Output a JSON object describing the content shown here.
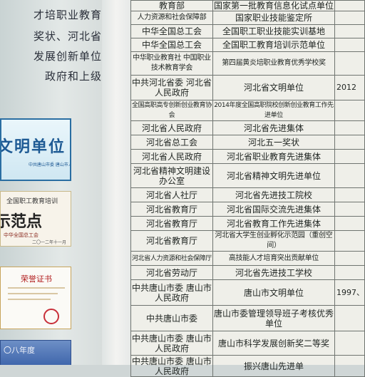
{
  "intro": {
    "lines": [
      "才培职业教育",
      "奖状、河北省",
      "发展创新单位",
      "政府和上级"
    ]
  },
  "plaques": [
    {
      "title": "文明单位",
      "subtitle": "中共唐山市委 唐山市人民政府"
    },
    {
      "line1": "全国职工教育培训",
      "line2": "示范点",
      "issuer": "中华全国总工会",
      "date": "二〇一二年十一月"
    },
    {
      "title": "荣誉证书"
    },
    {
      "title": "〇八年度"
    }
  ],
  "table": {
    "rows": [
      {
        "org": "教育部",
        "honor": "国家第一批教育信息化试点单位",
        "year": ""
      },
      {
        "org": "人力资源和社会保障部",
        "honor": "国家职业技能鉴定所",
        "year": ""
      },
      {
        "org": "中华全国总工会",
        "honor": "全国职工职业技能实训基地",
        "year": ""
      },
      {
        "org": "中华全国总工会",
        "honor": "全国职工教育培训示范单位",
        "year": ""
      },
      {
        "org": "中华职业教育社 中国职业技术教育学会",
        "honor": "第四届黄炎培职业教育优秀学校奖",
        "year": ""
      },
      {
        "org": "中共河北省委 河北省人民政府",
        "honor": "河北省文明单位",
        "year": "2012"
      },
      {
        "org": "全国高职高专创新创业教育协会",
        "honor": "2014年度全国高职院校创新创业教育工作先进单位",
        "year": ""
      },
      {
        "org": "河北省人民政府",
        "honor": "河北省先进集体",
        "year": ""
      },
      {
        "org": "河北省总工会",
        "honor": "河北五一奖状",
        "year": ""
      },
      {
        "org": "河北省人民政府",
        "honor": "河北省职业教育先进集体",
        "year": ""
      },
      {
        "org": "河北省精神文明建设办公室",
        "honor": "河北省精神文明先进单位",
        "year": ""
      },
      {
        "org": "河北省人社厅",
        "honor": "河北省先进技工院校",
        "year": ""
      },
      {
        "org": "河北省教育厅",
        "honor": "河北省国际交流先进集体",
        "year": ""
      },
      {
        "org": "河北省教育厅",
        "honor": "河北省教育工作先进集体",
        "year": ""
      },
      {
        "org": "河北省教育厅",
        "honor": "河北省大学生创业孵化示范园（重创空间）",
        "year": ""
      },
      {
        "org": "河北省人力资源和社会保障厅",
        "honor": "高技能人才培育突出贡献单位",
        "year": ""
      },
      {
        "org": "河北省劳动厅",
        "honor": "河北省先进技工学校",
        "year": ""
      },
      {
        "org": "中共唐山市委 唐山市人民政府",
        "honor": "唐山市文明单位",
        "year": "1997、"
      },
      {
        "org": "中共唐山市委",
        "honor": "唐山市委管理领导班子考核优秀单位",
        "year": ""
      },
      {
        "org": "中共唐山市委 唐山市人民政府",
        "honor": "唐山市科学发展创新奖二等奖",
        "year": ""
      },
      {
        "org": "中共唐山市委 唐山市人民政府",
        "honor": "振兴唐山先进单",
        "year": ""
      }
    ]
  }
}
